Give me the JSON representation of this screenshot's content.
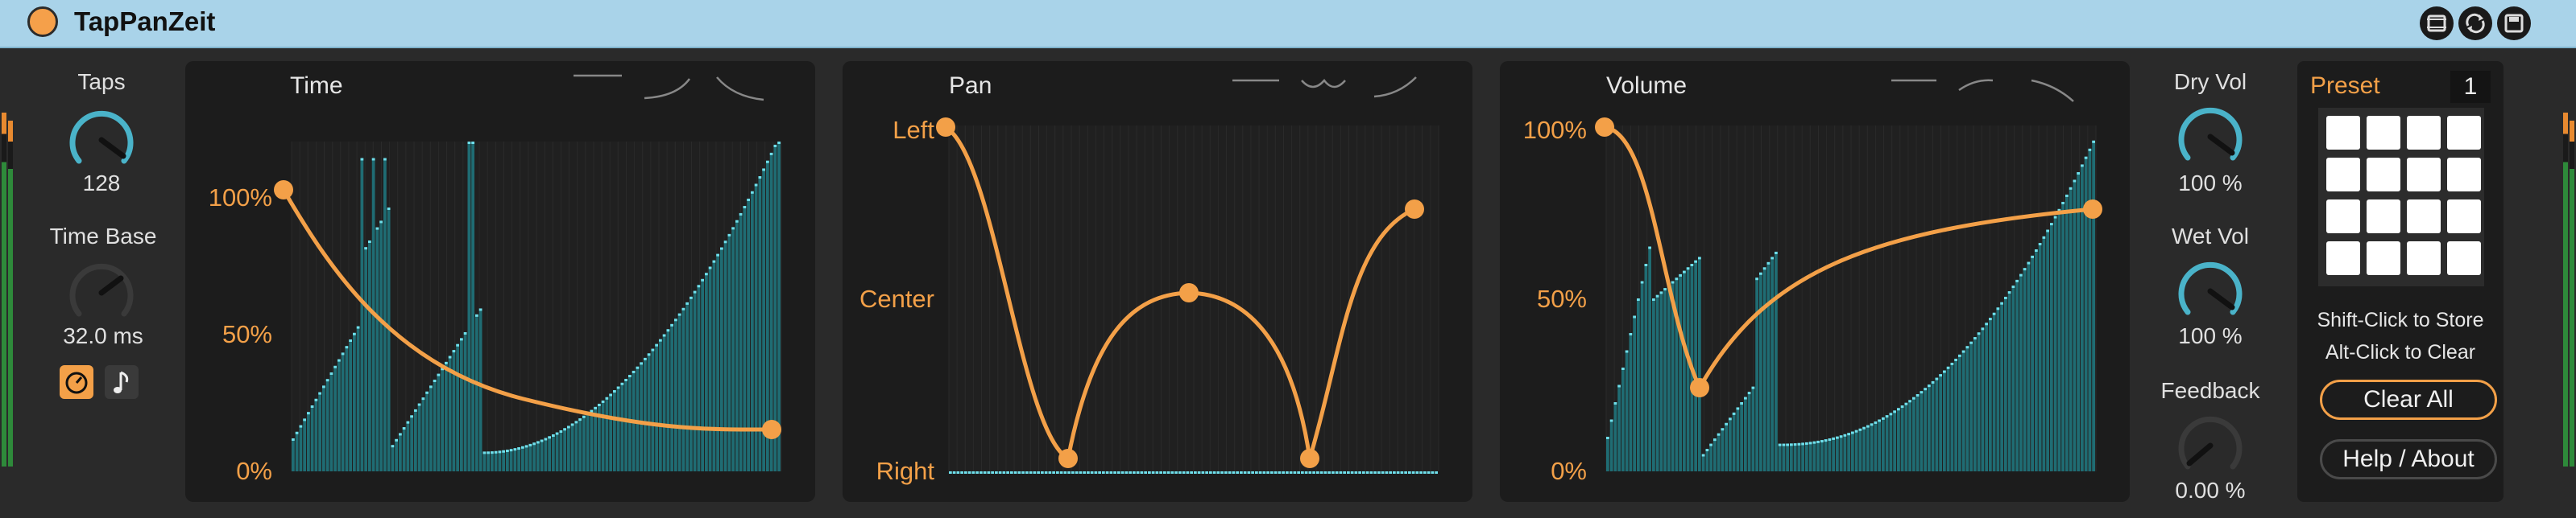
{
  "device": {
    "title": "TapPanZeit"
  },
  "left": {
    "taps_label": "Taps",
    "taps_value": "128",
    "timebase_label": "Time Base",
    "timebase_value": "32.0 ms"
  },
  "panels": {
    "time": {
      "title": "Time",
      "y_labels": [
        "100%",
        "50%",
        "0%"
      ]
    },
    "pan": {
      "title": "Pan",
      "y_labels": [
        "Left",
        "Center",
        "Right"
      ]
    },
    "volume": {
      "title": "Volume",
      "y_labels": [
        "100%",
        "50%",
        "0%"
      ]
    }
  },
  "right": {
    "dry_label": "Dry Vol",
    "dry_value": "100 %",
    "wet_label": "Wet Vol",
    "wet_value": "100 %",
    "feedback_label": "Feedback",
    "feedback_value": "0.00 %"
  },
  "preset": {
    "label": "Preset",
    "number": "1",
    "hint1": "Shift-Click to Store",
    "hint2": "Alt-Click to Clear",
    "clear_label": "Clear All",
    "help_label": "Help / About"
  },
  "colors": {
    "accent": "#f3a048",
    "knob": "#4ab3c9",
    "bars": "#1f6c73",
    "titlebar": "#a9d3e9"
  }
}
